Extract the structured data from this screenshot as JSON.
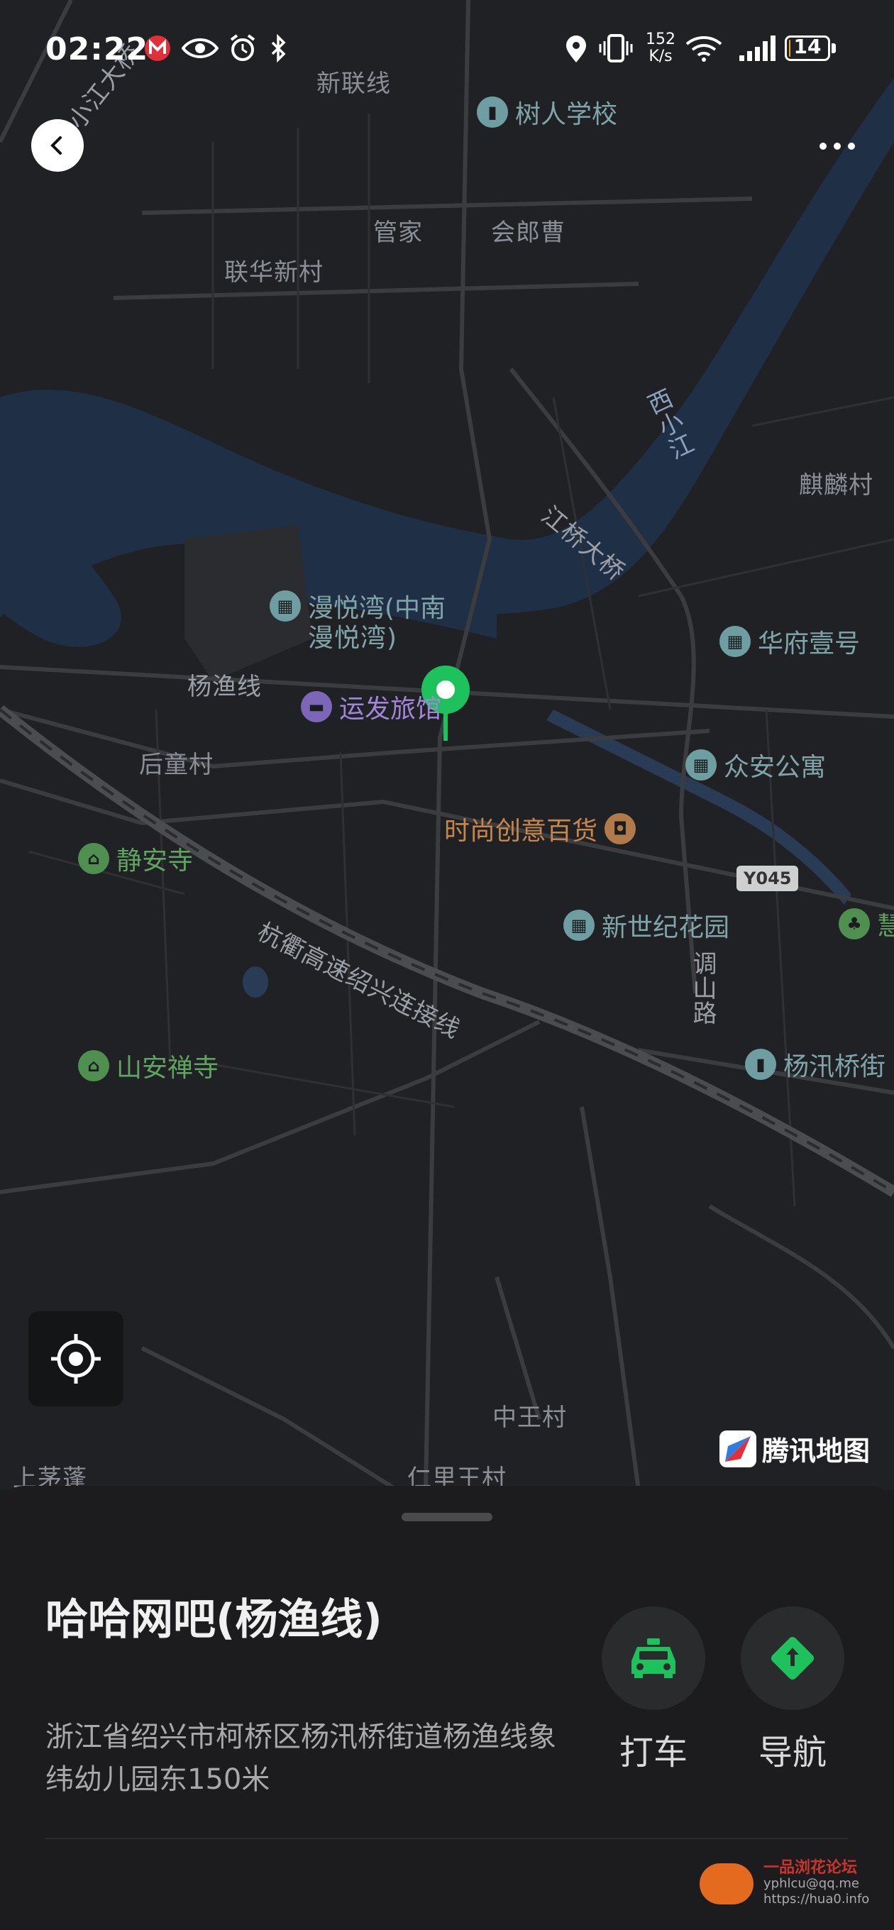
{
  "status_bar": {
    "time": "02:22",
    "net_speed_value": "152",
    "net_speed_unit": "K/s",
    "battery_level": "14",
    "battery_fraction": 0.14,
    "battery_color": "#f2a81d",
    "icons": [
      "metro-icon",
      "eye-icon",
      "alarm-icon",
      "bluetooth-icon",
      "location-icon",
      "vibrate-icon",
      "wifi-icon",
      "signal-icon"
    ]
  },
  "map": {
    "labels": {
      "xinlian": "新联线",
      "guanjia": "管家",
      "huilangcao": "会郎曹",
      "lianhua": "联华新村",
      "xixiaojiang": "西小江",
      "jiangqiao": "江桥大桥",
      "qilin": "麒麟村",
      "yangyu": "杨渔线",
      "houtong": "后童村",
      "hangqu": "杭衢高速绍兴连接线",
      "tiaoshan": "调山路",
      "zhongwang": "中王村",
      "renliwang": "仁里王村",
      "shangmao": "上茅蓬",
      "xiaojiang_bridge": "小江大桥"
    },
    "pois": {
      "shuren": "树人学校",
      "manyue": "漫悦湾(中南",
      "manyue2": "漫悦湾)",
      "huafu": "华府壹号",
      "yunfa": "运发旅馆",
      "zhongan": "众安公寓",
      "shishang": "时尚创意百货",
      "jingan": "静安寺",
      "xinshiji": "新世纪花园",
      "shanan": "山安禅寺",
      "yangxun": "杨汛桥街",
      "hui": "慧"
    },
    "road_shield": "Y045",
    "marker_color": "#1ec25c",
    "brand": "腾讯地图"
  },
  "sheet": {
    "name": "哈哈网吧(杨渔线)",
    "address": "浙江省绍兴市柯桥区杨汛桥街道杨渔线象纬幼儿园东150米",
    "taxi_label": "打车",
    "nav_label": "导航",
    "accent": "#1ec25c",
    "watermark_title": "一品浏花论坛",
    "watermark_line1": "yphlcu@qq.me",
    "watermark_line2": "https://hua0.info"
  }
}
